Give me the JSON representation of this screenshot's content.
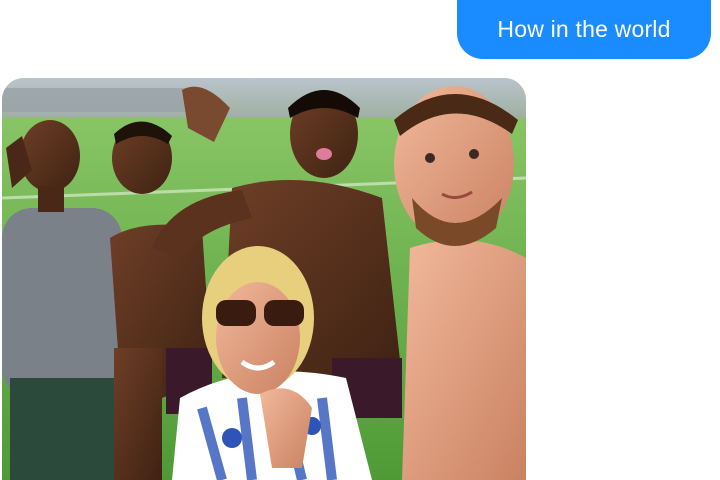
{
  "messages": [
    {
      "direction": "outgoing",
      "kind": "text",
      "text": "How in the world",
      "bubble_color": "#1a8cff",
      "text_color": "#ffffff"
    },
    {
      "direction": "incoming",
      "kind": "image",
      "scene": "group-selfie-on-football-field"
    }
  ]
}
